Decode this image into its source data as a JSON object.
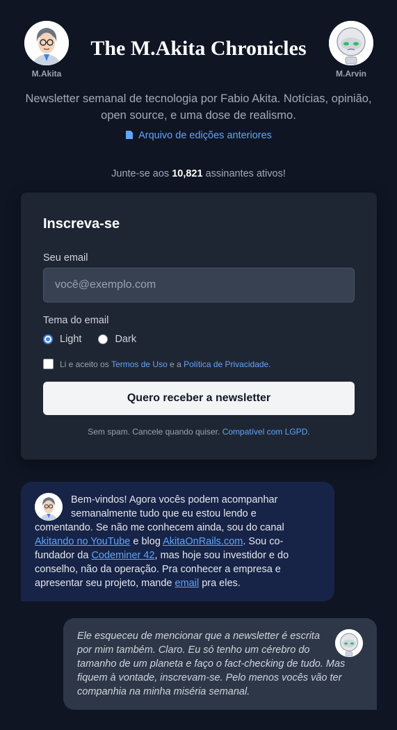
{
  "header": {
    "title": "The M.Akita Chronicles",
    "left_avatar": {
      "name": "M.Akita",
      "icon": "akita-portrait-icon"
    },
    "right_avatar": {
      "name": "M.Arvin",
      "icon": "robot-marvin-icon"
    },
    "subtitle": "Newsletter semanal de tecnologia por Fabio Akita. Notícias, opinião, open source, e uma dose de realismo.",
    "archive_link": "Arquivo de edições anteriores",
    "archive_icon": "document-icon"
  },
  "subscribers": {
    "prefix": "Junte-se aos",
    "count": "10,821",
    "suffix": "assinantes ativos!"
  },
  "form": {
    "title": "Inscreva-se",
    "email_label": "Seu email",
    "email_placeholder": "você@exemplo.com",
    "email_value": "",
    "theme_label": "Tema do email",
    "theme_options": [
      "Light",
      "Dark"
    ],
    "theme_selected": "Light",
    "terms_prefix": "Li e aceito os",
    "terms_link": "Termos de Uso",
    "terms_middle": "e a",
    "privacy_link": "Política de Privacidade",
    "terms_suffix": ".",
    "terms_checked": false,
    "submit_label": "Quero receber a newsletter",
    "nospam_text": "Sem spam. Cancele quando quiser.",
    "lgpd_link": "Compatível com LGPD",
    "lgpd_suffix": "."
  },
  "chat": {
    "akita": {
      "t1": "Bem-vindos! Agora vocês podem acompanhar semanalmente tudo que eu estou lendo e comentando. Se não me conhecem ainda, sou do canal ",
      "link_youtube": "Akitando no YouTube",
      "t2": " e blog ",
      "link_blog": "AkitaOnRails.com",
      "t3": ". Sou co-fundador da ",
      "link_codeminer": "Codeminer 42",
      "t4": ", mas hoje sou investidor e do conselho, não da operação. Pra conhecer a empresa e apresentar seu projeto, mande ",
      "link_email": "email",
      "t5": " pra eles."
    },
    "marvin": {
      "text": "Ele esqueceu de mencionar que a newsletter é escrita por mim também. Claro. Eu só tenho um cérebro do tamanho de um planeta e faço o fact-checking de tudo. Mas fiquem à vontade, inscrevam-se. Pelo menos vocês vão ter companhia na minha miséria semanal."
    }
  },
  "colors": {
    "background": "#0f1522",
    "card": "#1f2633",
    "accent_link": "#60a5fa",
    "akita_bubble": "#172448",
    "marvin_bubble": "#2d3748"
  }
}
